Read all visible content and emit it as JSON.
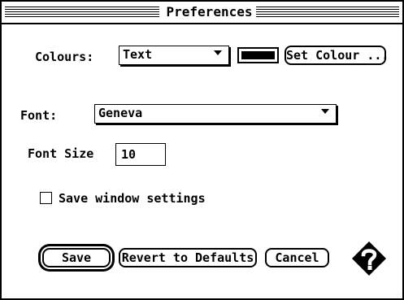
{
  "window": {
    "title": "Preferences"
  },
  "colours": {
    "label": "Colours:",
    "popup_value": "Text",
    "swatch_color": "#000000",
    "set_button": "Set Colour ..."
  },
  "font": {
    "label": "Font:",
    "popup_value": "Geneva"
  },
  "font_size": {
    "label": "Font Size",
    "value": "10"
  },
  "save_window": {
    "label": "Save window settings",
    "checked": false
  },
  "buttons": {
    "save": "Save",
    "revert": "Revert to Defaults",
    "cancel": "Cancel"
  },
  "icons": {
    "help": "help-diamond-icon"
  }
}
